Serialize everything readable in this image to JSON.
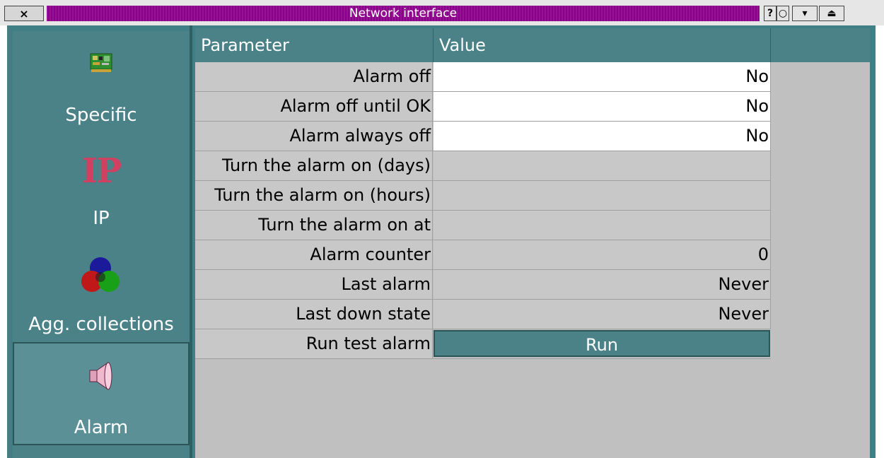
{
  "window": {
    "title": "Network interface",
    "close_label": "×",
    "buttons": [
      "?",
      "○",
      "▾",
      "⏏"
    ]
  },
  "sidebar": {
    "items": [
      {
        "label": "Specific",
        "icon": "network-card-icon",
        "selected": false
      },
      {
        "label": "IP",
        "icon": "ip-icon",
        "icon_text": "IP",
        "selected": false
      },
      {
        "label": "Agg. collections",
        "icon": "rgb-circles-icon",
        "selected": false
      },
      {
        "label": "Alarm",
        "icon": "speaker-icon",
        "selected": true
      }
    ]
  },
  "table": {
    "headers": [
      "Parameter",
      "Value"
    ],
    "rows": [
      {
        "param": "Alarm off",
        "value": "No",
        "editable": true
      },
      {
        "param": "Alarm off until OK",
        "value": "No",
        "editable": true
      },
      {
        "param": "Alarm always off",
        "value": "No",
        "editable": true
      },
      {
        "param": "Turn the alarm on (days)",
        "value": "",
        "editable": false
      },
      {
        "param": "Turn the alarm on (hours)",
        "value": "",
        "editable": false
      },
      {
        "param": "Turn the alarm on at",
        "value": "",
        "editable": false
      },
      {
        "param": "Alarm counter",
        "value": "0",
        "editable": false
      },
      {
        "param": "Last alarm",
        "value": "Never",
        "editable": false
      },
      {
        "param": "Last down state",
        "value": "Never",
        "editable": false
      }
    ],
    "run_row": {
      "param": "Run test alarm",
      "button_label": "Run"
    }
  },
  "colors": {
    "title_stripe": "#8b008b",
    "teal": "#4b8287",
    "grey": "#c8c8c8"
  }
}
